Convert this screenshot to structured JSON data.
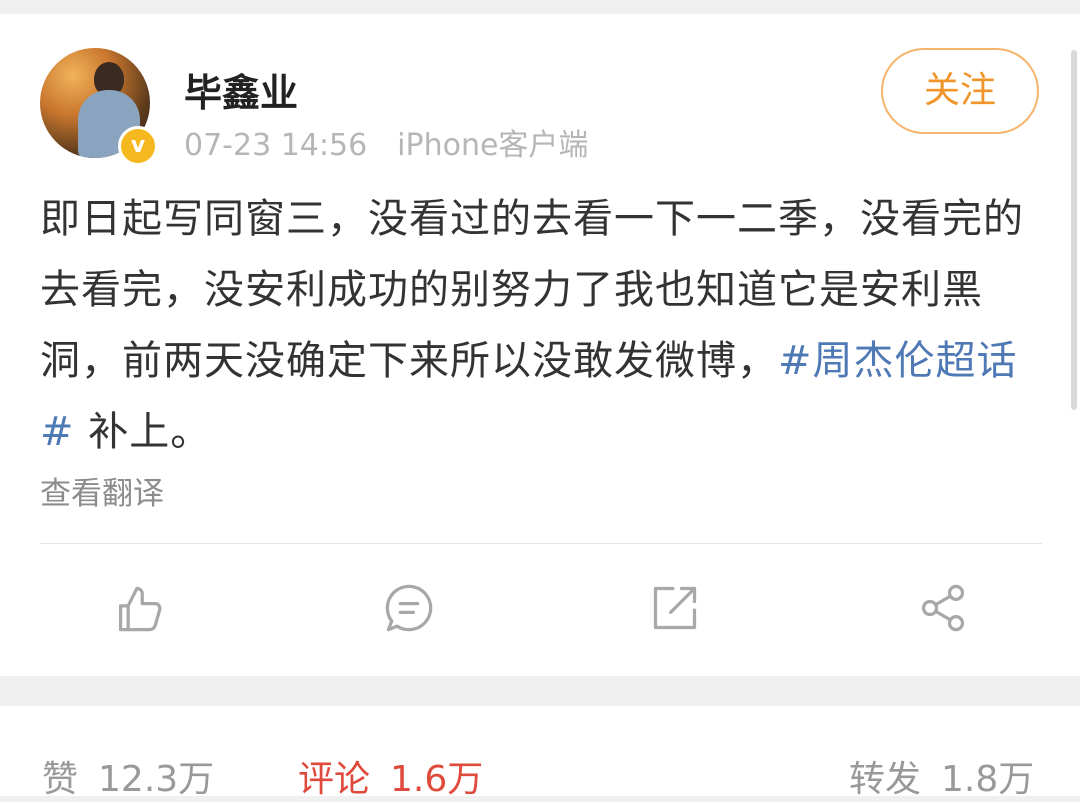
{
  "post": {
    "username": "毕鑫业",
    "time": "07-23 14:56",
    "source": "iPhone客户端",
    "follow_label": "关注",
    "badge": "v",
    "text_before": "即日起写同窗三，没看过的去看一下一二季，没看完的去看完，没安利成功的别努力了我也知道它是安利黑洞，前两天没确定下来所以没敢发微博，",
    "topic": "#周杰伦超话#",
    "text_after": " 补上。",
    "translate_label": "查看翻译"
  },
  "actions": {
    "like_icon": "thumbs-up-icon",
    "comment_icon": "comment-icon",
    "repost_icon": "repost-icon",
    "share_icon": "share-icon"
  },
  "stats": {
    "likes_label": "赞",
    "likes_value": "12.3万",
    "comments_label": "评论",
    "comments_value": "1.6万",
    "reposts_label": "转发",
    "reposts_value": "1.8万"
  },
  "colors": {
    "accent_orange": "#f0952a",
    "topic_blue": "#4f79b5",
    "active_red": "#e04a3c"
  }
}
